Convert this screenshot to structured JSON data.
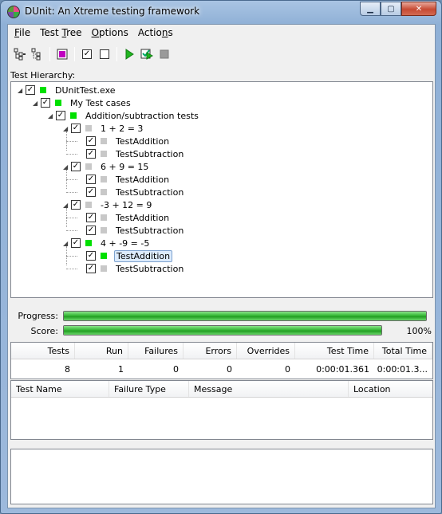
{
  "window": {
    "title": "DUnit: An Xtreme testing framework",
    "minimize": "▁",
    "maximize": "▢",
    "close": "✕"
  },
  "menu": [
    {
      "label_u": "F",
      "label_rest": "ile"
    },
    {
      "label_pre": "Test ",
      "label_u": "T",
      "label_rest": "ree"
    },
    {
      "label_u": "O",
      "label_rest": "ptions"
    },
    {
      "label_pre": "Actio",
      "label_u": "n",
      "label_rest": "s"
    }
  ],
  "toolbar": {
    "icons": [
      "select-all-icon",
      "deselect-all-icon",
      "select-failed-icon",
      "check-icon",
      "uncheck-icon",
      "run-icon",
      "run-selected-icon",
      "stop-icon"
    ],
    "check_glyph": "✓",
    "run_glyph": "▶"
  },
  "tree": {
    "label": "Test Hierarchy:",
    "nodes": [
      {
        "text": "DUnitTest.exe",
        "status": "green"
      },
      {
        "text": "My Test cases",
        "status": "green"
      },
      {
        "text": "Addition/subtraction tests",
        "status": "green"
      },
      {
        "text": "1 + 2 = 3",
        "status": "gray"
      },
      {
        "text": "TestAddition",
        "status": "gray"
      },
      {
        "text": "TestSubtraction",
        "status": "gray"
      },
      {
        "text": "6 + 9 = 15",
        "status": "gray"
      },
      {
        "text": "TestAddition",
        "status": "gray"
      },
      {
        "text": "TestSubtraction",
        "status": "gray"
      },
      {
        "text": "-3 + 12 = 9",
        "status": "gray"
      },
      {
        "text": "TestAddition",
        "status": "gray"
      },
      {
        "text": "TestSubtraction",
        "status": "gray"
      },
      {
        "text": "4 + -9 = -5",
        "status": "green"
      },
      {
        "text": "TestAddition",
        "status": "green",
        "selected": true
      },
      {
        "text": "TestSubtraction",
        "status": "gray"
      }
    ],
    "check_glyph": "✓",
    "expand_glyph": "◢"
  },
  "progress": {
    "label": "Progress:",
    "fraction": 1.0
  },
  "score": {
    "label": "Score:",
    "fraction": 1.0,
    "text": "100%"
  },
  "stats": {
    "headers": [
      "Tests",
      "Run",
      "Failures",
      "Errors",
      "Overrides",
      "Test Time",
      "Total Time"
    ],
    "values": [
      "8",
      "1",
      "0",
      "0",
      "0",
      "0:00:01.361",
      "0:00:01.3..."
    ]
  },
  "failures": {
    "headers": [
      "Test Name",
      "Failure Type",
      "Message",
      "Location"
    ]
  },
  "colors": {
    "pass": "#00e000",
    "not_run": "#c8c8c8",
    "progress": "#2fb32f"
  }
}
